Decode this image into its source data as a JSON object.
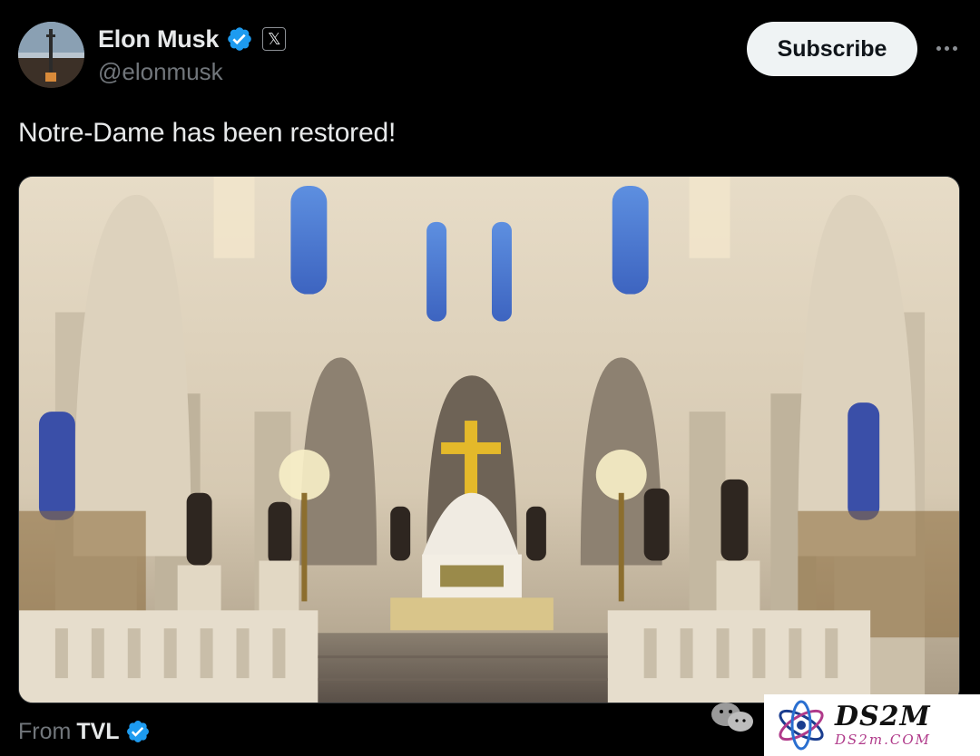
{
  "author": {
    "display_name": "Elon Musk",
    "handle": "@elonmusk",
    "verified_icon": "verified-badge-icon",
    "affiliation_icon": "x-logo-icon",
    "affiliation_glyph": "𝕏"
  },
  "actions": {
    "subscribe_label": "Subscribe",
    "more_icon": "more-options-icon"
  },
  "tweet": {
    "text": "Notre-Dame has been restored!"
  },
  "media": {
    "type": "video-frame",
    "subject": "cathedral-interior-altar"
  },
  "attribution": {
    "from_label": "From",
    "source": "TVL",
    "verified_icon": "verified-badge-icon"
  },
  "watermark": {
    "brand": "DS2M",
    "domain": "DS2m.COM"
  },
  "colors": {
    "background": "#000000",
    "text_primary": "#e7e9ea",
    "text_secondary": "#71767b",
    "verified_blue": "#1d9bf0",
    "button_bg": "#eff3f4",
    "button_text": "#0f1419",
    "cross_gold": "#e4b92a"
  }
}
